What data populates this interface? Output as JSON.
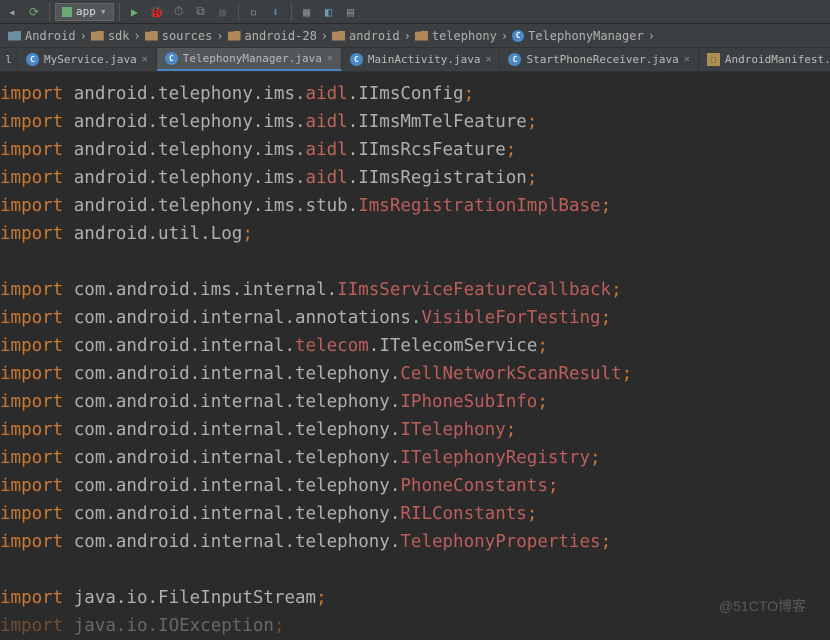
{
  "toolbar": {
    "run_config": "app"
  },
  "breadcrumbs": [
    {
      "icon": "module",
      "label": "Android"
    },
    {
      "icon": "folder",
      "label": "sdk"
    },
    {
      "icon": "folder",
      "label": "sources"
    },
    {
      "icon": "folder",
      "label": "android-28"
    },
    {
      "icon": "folder",
      "label": "android"
    },
    {
      "icon": "folder",
      "label": "telephony"
    },
    {
      "icon": "class",
      "label": "TelephonyManager"
    }
  ],
  "tabs": [
    {
      "label": "l",
      "type": "edge"
    },
    {
      "label": "MyService.java",
      "type": "java"
    },
    {
      "label": "TelephonyManager.java",
      "type": "java",
      "active": true
    },
    {
      "label": "MainActivity.java",
      "type": "java"
    },
    {
      "label": "StartPhoneReceiver.java",
      "type": "java"
    },
    {
      "label": "AndroidManifest.xml",
      "type": "xml"
    }
  ],
  "code": [
    {
      "kw": "import",
      "segs": [
        {
          "t": " android.telephony.ims.",
          "c": "txt"
        },
        {
          "t": "aidl",
          "c": "aidl"
        },
        {
          "t": ".IImsConfig",
          "c": "txt"
        }
      ]
    },
    {
      "kw": "import",
      "segs": [
        {
          "t": " android.telephony.ims.",
          "c": "txt"
        },
        {
          "t": "aidl",
          "c": "aidl"
        },
        {
          "t": ".IImsMmTelFeature",
          "c": "txt"
        }
      ]
    },
    {
      "kw": "import",
      "segs": [
        {
          "t": " android.telephony.ims.",
          "c": "txt"
        },
        {
          "t": "aidl",
          "c": "aidl"
        },
        {
          "t": ".IImsRcsFeature",
          "c": "txt"
        }
      ]
    },
    {
      "kw": "import",
      "segs": [
        {
          "t": " android.telephony.ims.",
          "c": "txt"
        },
        {
          "t": "aidl",
          "c": "aidl"
        },
        {
          "t": ".IImsRegistration",
          "c": "txt"
        }
      ]
    },
    {
      "kw": "import",
      "segs": [
        {
          "t": " android.telephony.ims.stub.",
          "c": "txt"
        },
        {
          "t": "ImsRegistrationImplBase",
          "c": "unres"
        }
      ]
    },
    {
      "kw": "import",
      "segs": [
        {
          "t": " android.util.Log",
          "c": "txt"
        }
      ]
    },
    {
      "blank": true
    },
    {
      "kw": "import",
      "segs": [
        {
          "t": " com.android.ims.internal.",
          "c": "txt"
        },
        {
          "t": "IImsServiceFeatureCallback",
          "c": "unres"
        }
      ]
    },
    {
      "kw": "import",
      "segs": [
        {
          "t": " com.android.internal.annotations.",
          "c": "txt"
        },
        {
          "t": "VisibleForTesting",
          "c": "unres"
        }
      ]
    },
    {
      "kw": "import",
      "segs": [
        {
          "t": " com.android.internal.",
          "c": "txt"
        },
        {
          "t": "telecom",
          "c": "telecom"
        },
        {
          "t": ".ITelecomService",
          "c": "txt"
        }
      ]
    },
    {
      "kw": "import",
      "segs": [
        {
          "t": " com.android.internal.telephony.",
          "c": "txt"
        },
        {
          "t": "CellNetworkScanResult",
          "c": "unres"
        }
      ]
    },
    {
      "kw": "import",
      "segs": [
        {
          "t": " com.android.internal.telephony.",
          "c": "txt"
        },
        {
          "t": "IPhoneSubInfo",
          "c": "unres"
        }
      ]
    },
    {
      "kw": "import",
      "segs": [
        {
          "t": " com.android.internal.telephony.",
          "c": "txt"
        },
        {
          "t": "ITelephony",
          "c": "unres"
        }
      ]
    },
    {
      "kw": "import",
      "segs": [
        {
          "t": " com.android.internal.telephony.",
          "c": "txt"
        },
        {
          "t": "ITelephonyRegistry",
          "c": "unres"
        }
      ]
    },
    {
      "kw": "import",
      "segs": [
        {
          "t": " com.android.internal.telephony.",
          "c": "txt"
        },
        {
          "t": "PhoneConstants",
          "c": "unres"
        }
      ]
    },
    {
      "kw": "import",
      "segs": [
        {
          "t": " com.android.internal.telephony.",
          "c": "txt"
        },
        {
          "t": "RILConstants",
          "c": "unres"
        }
      ]
    },
    {
      "kw": "import",
      "segs": [
        {
          "t": " com.android.internal.telephony.",
          "c": "txt"
        },
        {
          "t": "TelephonyProperties",
          "c": "unres"
        }
      ]
    },
    {
      "blank": true
    },
    {
      "kw": "import",
      "segs": [
        {
          "t": " java.io.FileInputStream",
          "c": "txt"
        }
      ]
    },
    {
      "kw": "import",
      "segs": [
        {
          "t": " java.io.IOException",
          "c": "txt"
        }
      ],
      "cut": true
    }
  ],
  "watermark": "@51CTO博客"
}
